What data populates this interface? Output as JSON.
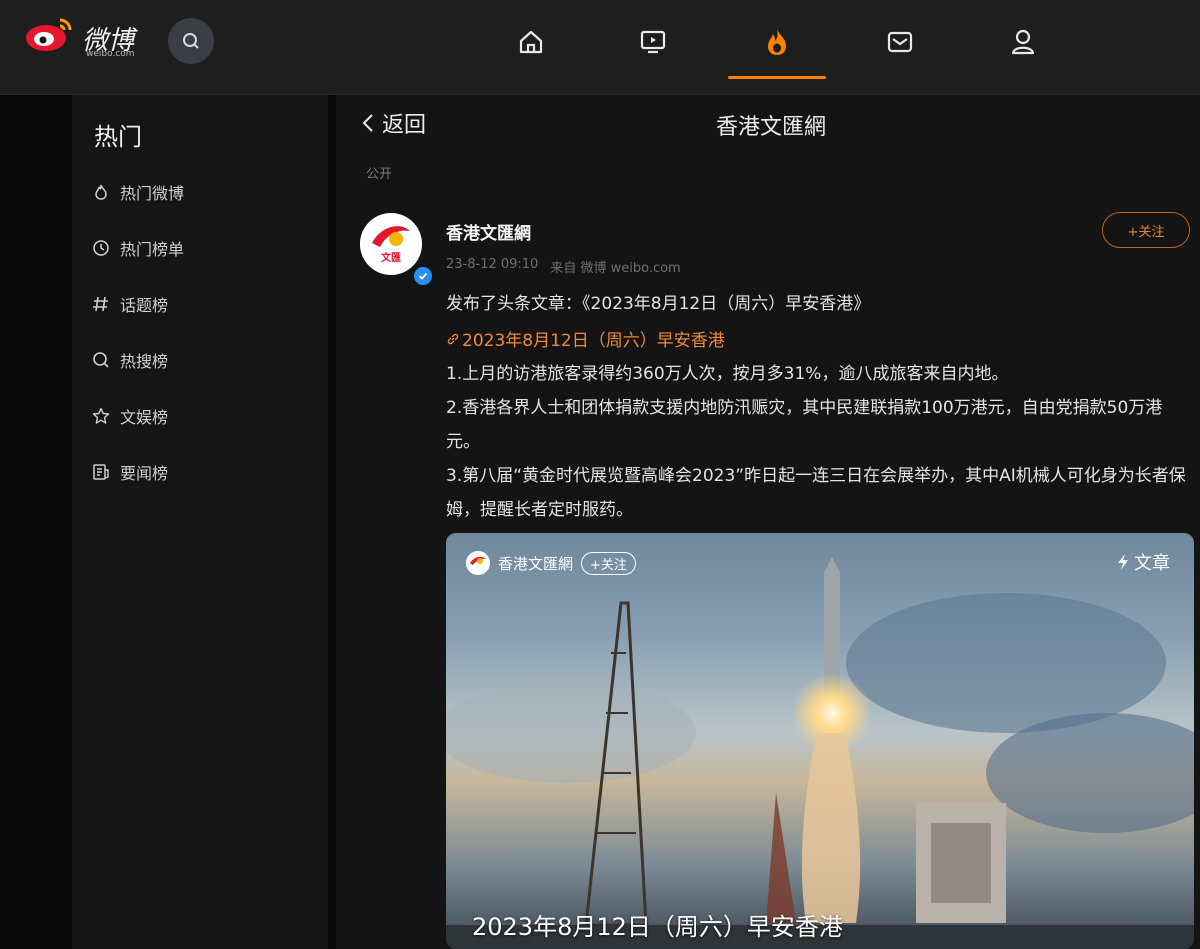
{
  "header": {
    "brand": "微博",
    "brand_sub": "weibo.com",
    "nav": [
      "home-icon",
      "video-icon",
      "hot-icon",
      "message-icon",
      "profile-icon"
    ],
    "accent": "#ff8200"
  },
  "sidebar": {
    "title": "热门",
    "items": [
      {
        "label": "热门微博",
        "icon": "flame-icon"
      },
      {
        "label": "热门榜单",
        "icon": "clock-icon"
      },
      {
        "label": "话题榜",
        "icon": "hashtag-icon"
      },
      {
        "label": "热搜榜",
        "icon": "search-icon"
      },
      {
        "label": "文娱榜",
        "icon": "star-icon"
      },
      {
        "label": "要闻榜",
        "icon": "news-icon"
      }
    ]
  },
  "main": {
    "back_label": "返回",
    "title": "香港文匯網",
    "visibility": "公开",
    "post": {
      "author": "香港文匯網",
      "time": "23-8-12 09:10",
      "source": "来自 微博 weibo.com",
      "follow_label": "+关注",
      "headline": "发布了头条文章：《2023年8月12日（周六）早安香港》",
      "article_link": "2023年8月12日（周六）早安香港",
      "paragraphs": [
        "1.上月的访港旅客录得约360万人次，按月多31%，逾八成旅客来自内地。",
        "2.香港各界人士和团体捐款支援内地防汛赈灾，其中民建联捐款100万港元，自由党捐款50万港元。",
        "3.第八届“黄金时代展览暨高峰会2023”昨日起一连三日在会展举办，其中AI机械人可化身为长者保姆，提醒长者定时服药。"
      ],
      "card": {
        "author": "香港文匯網",
        "follow_label": "+关注",
        "tag": "文章",
        "caption": "2023年8月12日（周六）早安香港"
      }
    }
  }
}
